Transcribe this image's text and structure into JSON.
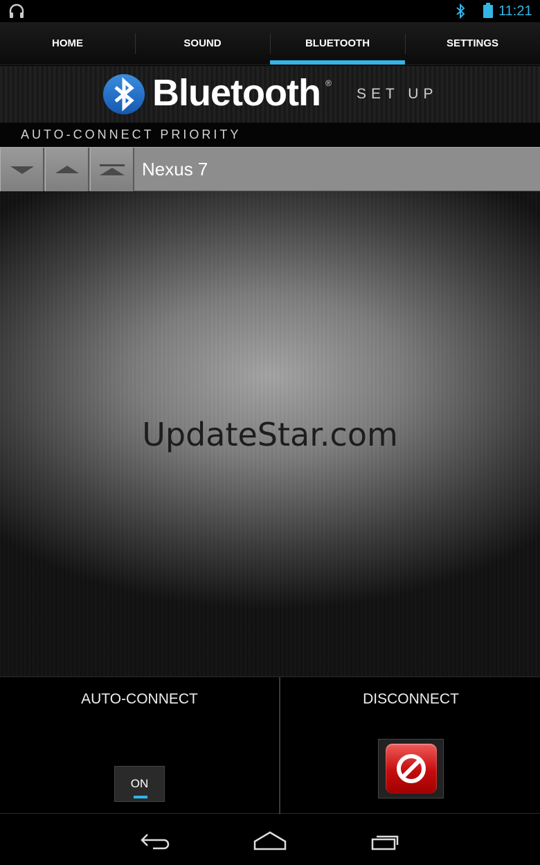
{
  "status_bar": {
    "time": "11:21",
    "accent_color": "#33b5e5",
    "icons": [
      "headphones-icon",
      "bluetooth-icon",
      "battery-icon"
    ]
  },
  "tabs": [
    {
      "label": "HOME",
      "active": false
    },
    {
      "label": "SOUND",
      "active": false
    },
    {
      "label": "BLUETOOTH",
      "active": true
    },
    {
      "label": "SETTINGS",
      "active": false
    }
  ],
  "header": {
    "logo_text": "Bluetooth",
    "registered_mark": "®",
    "subtitle": "SET UP"
  },
  "priority_section": {
    "title": "AUTO-CONNECT PRIORITY",
    "buttons": [
      "move-down-icon",
      "move-up-icon",
      "move-to-top-icon"
    ],
    "devices": [
      {
        "name": "Nexus 7"
      }
    ]
  },
  "watermark": "UpdateStar.com",
  "controls": {
    "auto_connect": {
      "label": "AUTO-CONNECT",
      "toggle_text": "ON"
    },
    "disconnect": {
      "label": "DISCONNECT",
      "icon": "no-entry-icon",
      "button_color": "#d11a1a"
    }
  },
  "nav_bar": {
    "buttons": [
      "back-icon",
      "home-icon",
      "recent-apps-icon"
    ]
  }
}
